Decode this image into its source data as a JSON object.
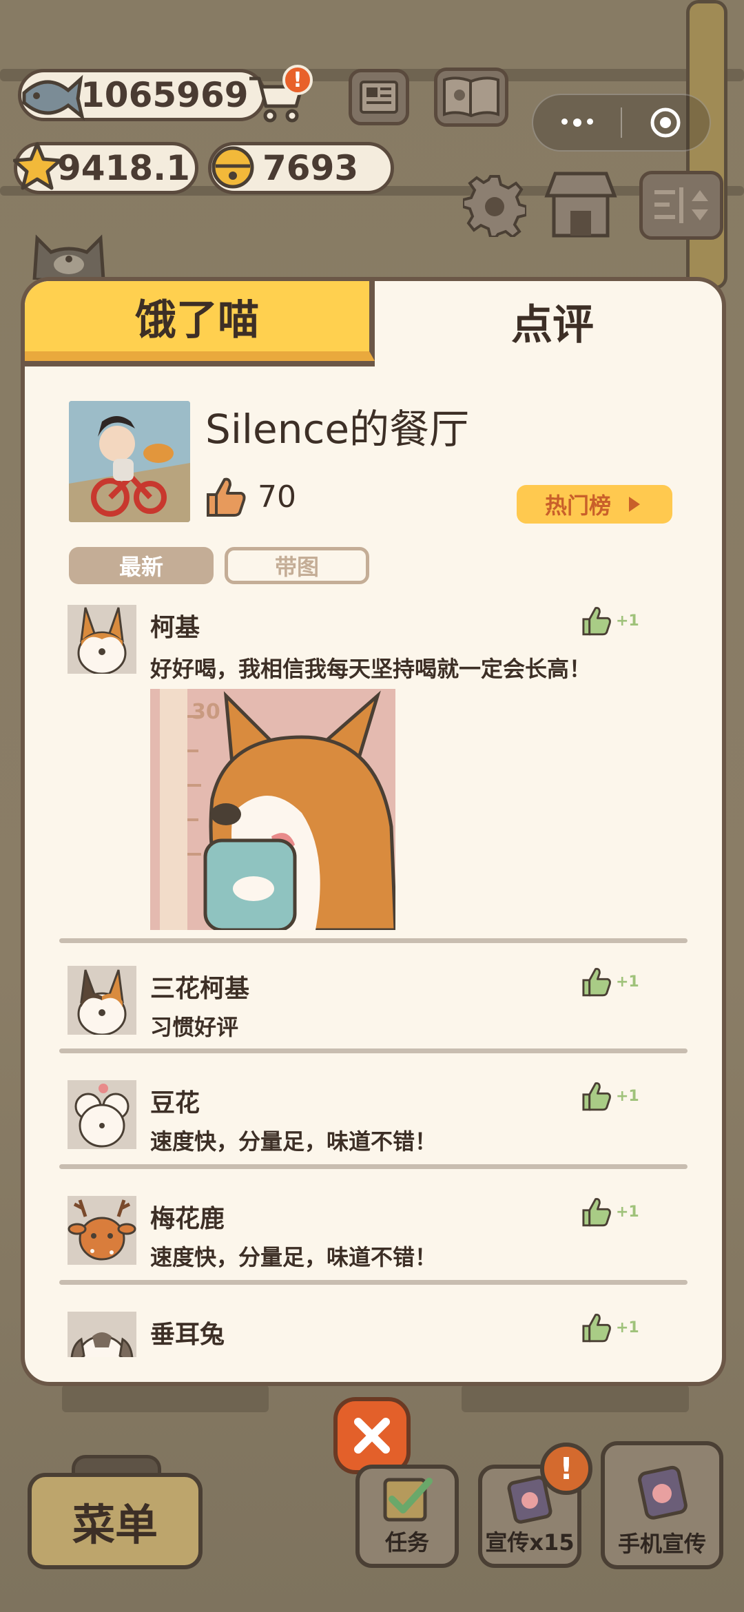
{
  "currencies": {
    "fish": "1065969",
    "star": "9418.1",
    "bell": "7693",
    "cart_badge": "!"
  },
  "tabs": {
    "hungry": "饿了喵",
    "review": "点评"
  },
  "restaurant": {
    "name": "Silence的餐厅",
    "likes": "70",
    "hot_list": "热门榜"
  },
  "filters": {
    "latest": "最新",
    "with_image": "带图"
  },
  "reviews": [
    {
      "name": "柯基",
      "text": "好好喝，我相信我每天坚持喝就一定会长高！",
      "plus": "+1"
    },
    {
      "name": "三花柯基",
      "text": "习惯好评",
      "plus": "+1"
    },
    {
      "name": "豆花",
      "text": "速度快，分量足，味道不错！",
      "plus": "+1"
    },
    {
      "name": "梅花鹿",
      "text": "速度快，分量足，味道不错！",
      "plus": "+1"
    },
    {
      "name": "垂耳兔",
      "text": "",
      "plus": "+1"
    }
  ],
  "review_image_text": "30",
  "bottom": {
    "menu": "菜单",
    "tasks": "任务",
    "promote": "宣传x15",
    "phone_promote": "手机宣传",
    "warn": "!"
  },
  "colors": {
    "tab_active": "#ffd04f",
    "panel_bg": "#fcf6eb",
    "border": "#6b5747",
    "thumb_green": "#9fc27a",
    "hot_btn": "#ffc94f",
    "close_btn": "#e3602a"
  }
}
